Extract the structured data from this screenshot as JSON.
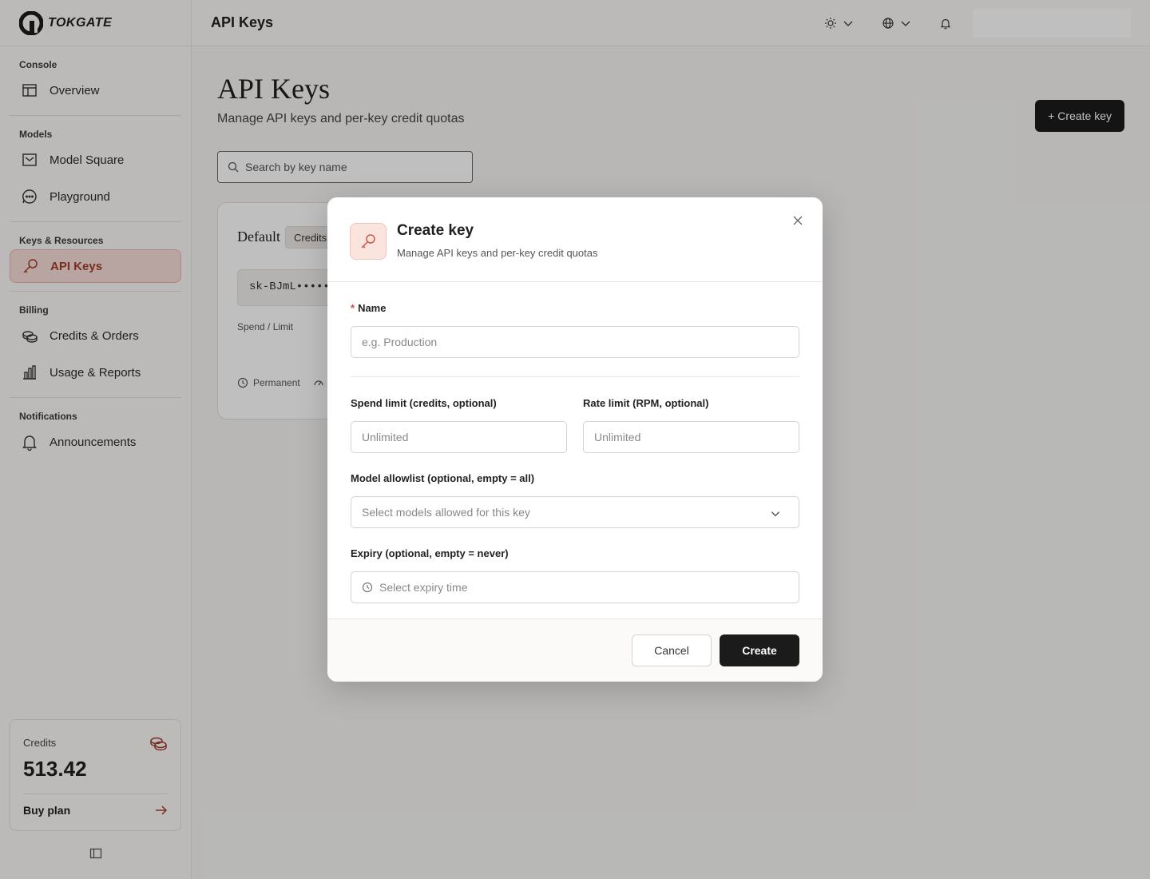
{
  "app": {
    "logo_text": "TOKGATE"
  },
  "sidebar": {
    "sections": [
      {
        "title": "Console",
        "items": [
          {
            "label": "Overview",
            "icon": "layout-icon"
          }
        ]
      },
      {
        "title": "Models",
        "items": [
          {
            "label": "Model Square",
            "icon": "inbox-icon"
          },
          {
            "label": "Playground",
            "icon": "chat-icon"
          }
        ]
      },
      {
        "title": "Keys & Resources",
        "items": [
          {
            "label": "API Keys",
            "icon": "key-icon",
            "active": true
          }
        ]
      },
      {
        "title": "Billing",
        "items": [
          {
            "label": "Credits & Orders",
            "icon": "coins-icon"
          },
          {
            "label": "Usage & Reports",
            "icon": "bar-chart-icon"
          }
        ]
      },
      {
        "title": "Notifications",
        "items": [
          {
            "label": "Announcements",
            "icon": "bell-icon"
          }
        ]
      }
    ],
    "credits": {
      "label": "Credits",
      "value": "513.42",
      "buy_label": "Buy plan"
    }
  },
  "header": {
    "title": "API Keys"
  },
  "page": {
    "title": "API Keys",
    "subtitle": "Manage API keys and per-key credit quotas",
    "create_button": "+ Create key",
    "search_placeholder": "Search by key name",
    "key_card": {
      "name": "Default",
      "badge": "Credits",
      "key_masked": "sk-BJmL••••••",
      "spend_label": "Spend / Limit",
      "expiry": "Permanent"
    }
  },
  "modal": {
    "title": "Create key",
    "subtitle": "Manage API keys and per-key credit quotas",
    "name_label": "Name",
    "name_placeholder": "e.g. Production",
    "spend_label": "Spend limit (credits, optional)",
    "spend_placeholder": "Unlimited",
    "rate_label": "Rate limit (RPM, optional)",
    "rate_placeholder": "Unlimited",
    "models_label": "Model allowlist (optional, empty = all)",
    "models_placeholder": "Select models allowed for this key",
    "expiry_label": "Expiry (optional, empty = never)",
    "expiry_placeholder": "Select expiry time",
    "cancel_label": "Cancel",
    "create_label": "Create"
  },
  "colors": {
    "accent": "#a33d2b",
    "active_bg": "#f6dcd7",
    "primary_button": "#1b1b1b"
  }
}
